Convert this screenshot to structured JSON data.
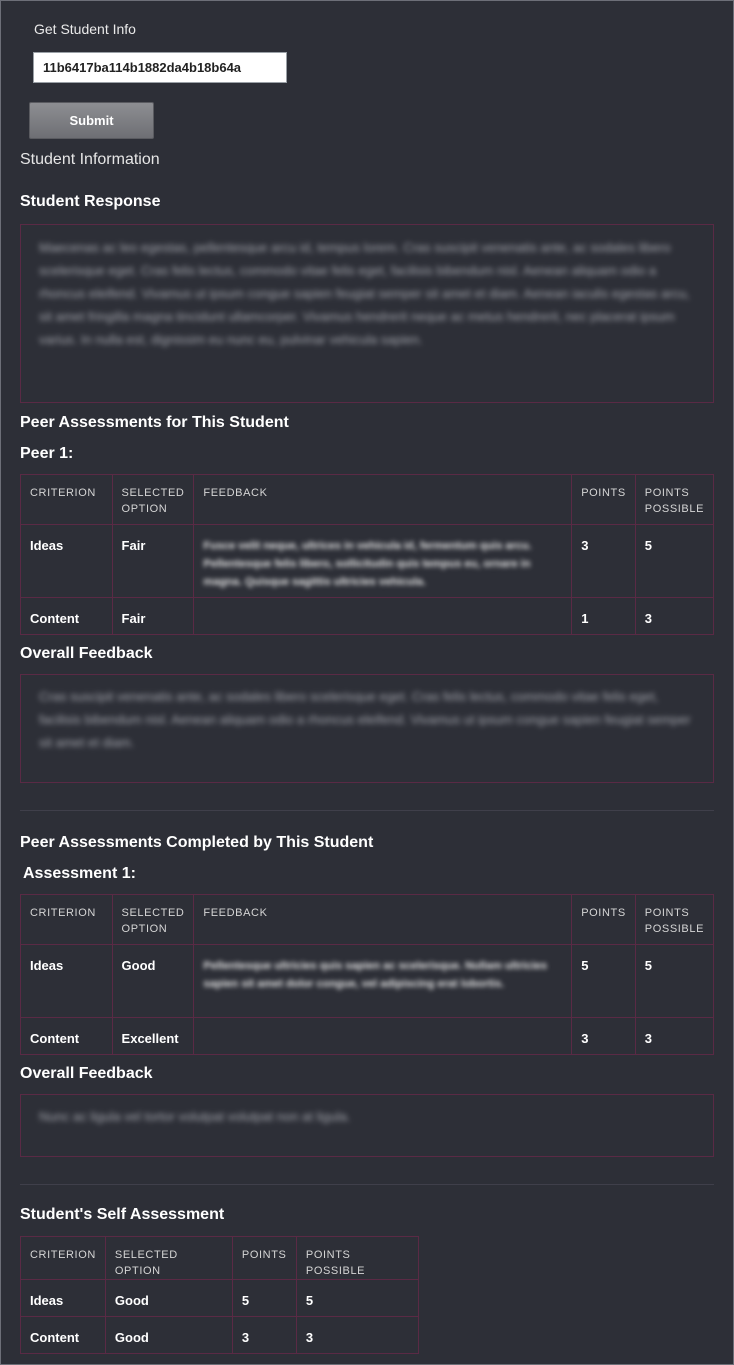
{
  "form": {
    "label": "Get Student Info",
    "student_id_value": "11b6417ba114b1882da4b18b64a",
    "submit_label": "Submit"
  },
  "info_title": "Student Information",
  "response": {
    "title": "Student Response",
    "text": "Maecenas ac leo egestas, pellentesque arcu id, tempus lorem. Cras suscipit venenatis ante, ac sodales libero scelerisque eget. Cras felis lectus, commodo vitae felis eget, facilisis bibendum nisl. Aenean aliquam odio a rhoncus eleifend. Vivamus ut ipsum congue sapien feugiat semper sit amet et diam. Aenean iaculis egestas arcu, sit amet fringilla magna tincidunt ullamcorper. Vivamus hendrerit neque ac metus hendrerit, nec placerat ipsum varius. In nulla est, dignissim eu nunc eu, pulvinar vehicula sapien."
  },
  "peer_for": {
    "title": "Peer Assessments for This Student",
    "peer_label": "Peer 1:",
    "headers": [
      "CRITERION",
      "SELECTED OPTION",
      "FEEDBACK",
      "POINTS",
      "POINTS POSSIBLE"
    ],
    "rows": [
      {
        "criterion": "Ideas",
        "option": "Fair",
        "feedback": "Fusce velit neque, ultrices in vehicula id, fermentum quis arcu. Pellentesque felis libero, sollicitudin quis tempus eu, ornare in magna. Quisque sagittis ultricies vehicula.",
        "points": "3",
        "possible": "5"
      },
      {
        "criterion": "Content",
        "option": "Fair",
        "feedback": "",
        "points": "1",
        "possible": "3"
      }
    ],
    "overall_title": "Overall Feedback",
    "overall_text": "Cras suscipit venenatis ante, ac sodales libero scelerisque eget. Cras felis lectus, commodo vitae felis eget, facilisis bibendum nisl. Aenean aliquam odio a rhoncus eleifend. Vivamus ut ipsum congue sapien feugiat semper sit amet et diam."
  },
  "peer_by": {
    "title": "Peer Assessments Completed by This Student",
    "assessment_label": "Assessment 1:",
    "headers": [
      "CRITERION",
      "SELECTED OPTION",
      "FEEDBACK",
      "POINTS",
      "POINTS POSSIBLE"
    ],
    "rows": [
      {
        "criterion": "Ideas",
        "option": "Good",
        "feedback": "Pellentesque ultricies quis sapien ac scelerisque. Nullam ultricies sapien sit amet dolor congue, vel adipiscing erat lobortis.",
        "points": "5",
        "possible": "5"
      },
      {
        "criterion": "Content",
        "option": "Excellent",
        "feedback": "",
        "points": "3",
        "possible": "3"
      }
    ],
    "overall_title": "Overall Feedback",
    "overall_text": "Nunc ac ligula vel tortor volutpat volutpat non at ligula."
  },
  "self": {
    "title": "Student's Self Assessment",
    "headers": [
      "CRITERION",
      "SELECTED OPTION",
      "POINTS",
      "POINTS POSSIBLE"
    ],
    "rows": [
      {
        "criterion": "Ideas",
        "option": "Good",
        "points": "5",
        "possible": "5"
      },
      {
        "criterion": "Content",
        "option": "Good",
        "points": "3",
        "possible": "3"
      }
    ]
  }
}
